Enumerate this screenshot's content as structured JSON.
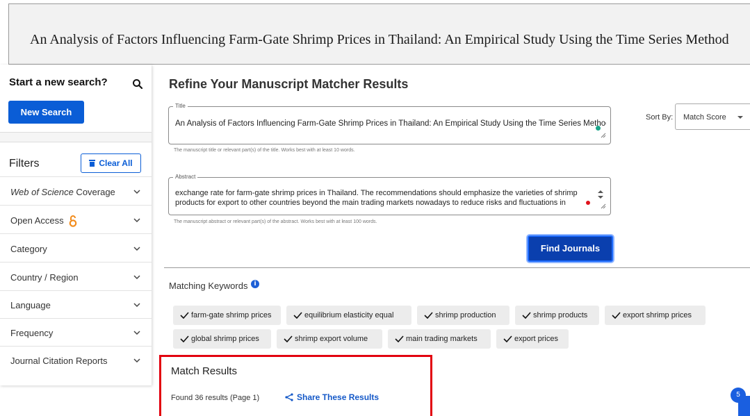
{
  "banner": {
    "title": "An Analysis of Factors Influencing Farm-Gate Shrimp Prices in Thailand: An Empirical Study Using the Time Series Method"
  },
  "sidebar": {
    "search_heading": "Start a new search?",
    "new_search_label": "New Search",
    "filters_label": "Filters",
    "clear_all_label": "Clear All",
    "filters": [
      {
        "label": "Web of Science Coverage",
        "italic_prefix": "Web of Science",
        "suffix": " Coverage"
      },
      {
        "label": "Open Access"
      },
      {
        "label": "Category"
      },
      {
        "label": "Country / Region"
      },
      {
        "label": "Language"
      },
      {
        "label": "Frequency"
      },
      {
        "label": "Journal Citation Reports"
      }
    ]
  },
  "main": {
    "title": "Refine Your Manuscript Matcher Results",
    "title_field": {
      "legend": "Title",
      "value": "An Analysis of Factors Influencing Farm-Gate Shrimp Prices in Thailand: An Empirical Study Using the Time Series Method",
      "helper": "The manuscript title or relevant part(s) of the title. Works best with at least 10 words."
    },
    "abstract_field": {
      "legend": "Abstract",
      "line1": "exchange rate for farm-gate shrimp prices in Thailand. The recommendations should emphasize the varieties of shrimp",
      "line2": "products for export to other countries beyond the main trading markets nowadays to reduce risks and fluctuations in",
      "helper": "The manuscript abstract or relevant part(s) of the abstract. Works best with at least 100 words."
    },
    "sort": {
      "label": "Sort By:",
      "value": "Match Score"
    },
    "find_button": "Find Journals",
    "keywords_heading": "Matching Keywords",
    "keywords": [
      "farm-gate shrimp prices",
      "equilibrium elasticity equal",
      "shrimp production",
      "shrimp products",
      "export shrimp prices",
      "global shrimp prices",
      "shrimp export volume",
      "main trading markets",
      "export prices"
    ],
    "results": {
      "title": "Match Results",
      "count": "Found 36 results (Page 1)",
      "share": "Share These Results"
    },
    "badge": "5"
  },
  "colors": {
    "primary": "#0a5dd6",
    "find_button": "#0a3fae",
    "highlight_border": "#e2000f",
    "open_access": "#f28c1c"
  }
}
